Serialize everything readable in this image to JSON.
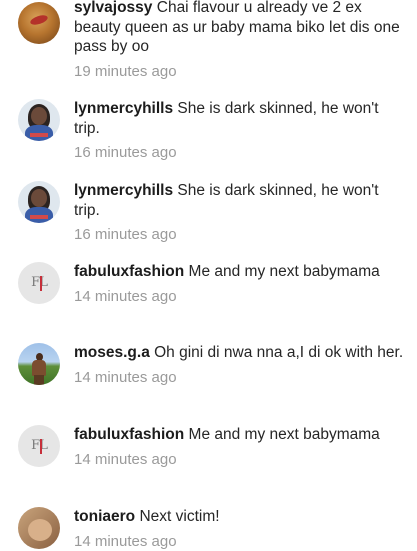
{
  "comments": [
    {
      "username": "sylvajossy",
      "text": "Chai flavour u already ve 2 ex beauty queen as ur baby mama biko let dis one pass by oo",
      "time": "19 minutes ago",
      "avatar": "portrait-lips"
    },
    {
      "username": "lynmercyhills",
      "text": "She is dark skinned, he won't trip.",
      "time": "16 minutes ago",
      "avatar": "portrait-woman"
    },
    {
      "username": "lynmercyhills",
      "text": "She is dark skinned, he won't trip.",
      "time": "16 minutes ago",
      "avatar": "portrait-woman"
    },
    {
      "username": "fabuluxfashion",
      "text": "Me and my next babymama",
      "time": "14 minutes ago",
      "avatar": "fashion-logo"
    },
    {
      "username": "moses.g.a",
      "text": "Oh gini di nwa nna a,I di ok with her.",
      "time": "14 minutes ago",
      "avatar": "portrait-man-outdoors"
    },
    {
      "username": "fabuluxfashion",
      "text": "Me and my next babymama",
      "time": "14 minutes ago",
      "avatar": "fashion-logo"
    },
    {
      "username": "toniaero",
      "text": "Next victim!",
      "time": "14 minutes ago",
      "avatar": "portrait-face"
    }
  ],
  "logo_text": "FL"
}
